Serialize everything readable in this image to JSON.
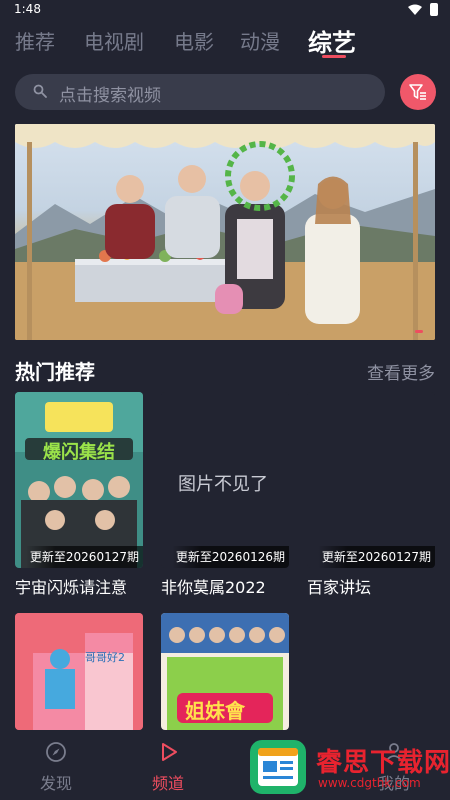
{
  "status": {
    "time": "1:48"
  },
  "tabs": [
    {
      "label": "推荐"
    },
    {
      "label": "电视剧"
    },
    {
      "label": "电影"
    },
    {
      "label": "动漫"
    },
    {
      "label": "综艺",
      "active": true
    }
  ],
  "search": {
    "placeholder": "点击搜索视频"
  },
  "section": {
    "title": "热门推荐",
    "more": "查看更多"
  },
  "cards": [
    {
      "title": "宇宙闪烁请注意",
      "badge": "更新至20260127期",
      "poster_text": "爆闪集结"
    },
    {
      "title": "非你莫属2022",
      "badge": "更新至20260126期",
      "missing": "图片不见了"
    },
    {
      "title": "百家讲坛",
      "badge": "更新至20260127期"
    },
    {
      "title": "",
      "poster_text": "哥哥好2"
    },
    {
      "title": "",
      "poster_text": "姐妹會"
    }
  ],
  "nav": [
    {
      "label": "发现",
      "icon": "compass-icon"
    },
    {
      "label": "频道",
      "icon": "play-icon",
      "active": true
    },
    {
      "label": "我的",
      "icon": "user-icon"
    }
  ],
  "watermark": {
    "name": "睿思下载网",
    "url": "www.cdgthk.com"
  },
  "colors": {
    "accent": "#ee4d5f",
    "background": "#222431",
    "search_bg": "#393c4b"
  }
}
